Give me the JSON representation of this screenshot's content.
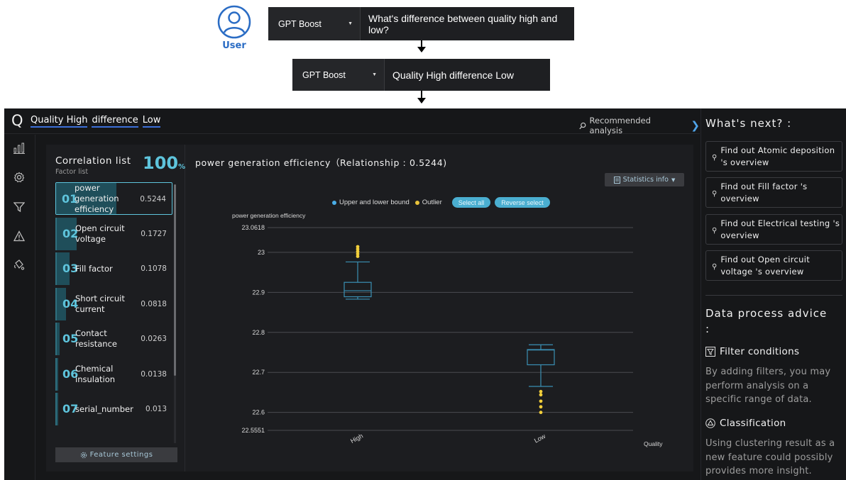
{
  "flow": {
    "user_label": "User",
    "query1": {
      "model": "GPT Boost",
      "text": "What's difference between quality high and low?"
    },
    "query2": {
      "model": "GPT Boost",
      "text": "Quality High difference Low"
    }
  },
  "app": {
    "logo": "Q",
    "breadcrumb": [
      "Quality High",
      "difference",
      "Low"
    ],
    "recommended": "Recommended analysis",
    "correlation": {
      "title": "Correlation list",
      "subtitle": "Factor list",
      "percent": "100",
      "percent_unit": "%",
      "factors": [
        {
          "num": "01",
          "name": "power generation efficiency",
          "value": "0.5244",
          "score": 0.5244,
          "active": true
        },
        {
          "num": "02",
          "name": "Open circuit voltage",
          "value": "0.1727",
          "score": 0.1727
        },
        {
          "num": "03",
          "name": "Fill factor",
          "value": "0.1078",
          "score": 0.1078
        },
        {
          "num": "04",
          "name": "Short circuit current",
          "value": "0.0818",
          "score": 0.0818
        },
        {
          "num": "05",
          "name": "Contact resistance",
          "value": "0.0263",
          "score": 0.0263
        },
        {
          "num": "06",
          "name": "Chemical insulation",
          "value": "0.0138",
          "score": 0.0138
        },
        {
          "num": "07",
          "name": "serial_number",
          "value": "0.013",
          "score": 0.013
        }
      ],
      "feature_settings": "Feature settings"
    },
    "chart_panel": {
      "title": "power generation efficiency（Relationship : 0.5244)",
      "stats_button": "Statistics info",
      "legend": {
        "bound": "Upper and lower bound",
        "outlier": "Outlier",
        "select_all": "Select all",
        "reverse_select": "Reverse select"
      }
    }
  },
  "chart_data": {
    "type": "box",
    "ylabel": "power generation efficiency",
    "xlabel": "Quality",
    "categories": [
      "High",
      "Low"
    ],
    "ylim": [
      22.5551,
      23.0618
    ],
    "yticks": [
      {
        "value": 23.0618,
        "label": "23.0618"
      },
      {
        "value": 23.0,
        "label": "23"
      },
      {
        "value": 22.9,
        "label": "22.9"
      },
      {
        "value": 22.8,
        "label": "22.8"
      },
      {
        "value": 22.7,
        "label": "22.7"
      },
      {
        "value": 22.6,
        "label": "22.6"
      },
      {
        "value": 22.5551,
        "label": "22.5551"
      }
    ],
    "boxes": [
      {
        "category": "High",
        "whisker_low": 22.883,
        "q1": 22.889,
        "median": 22.904,
        "q3": 22.925,
        "whisker_high": 22.976,
        "outliers": [
          22.99,
          22.996,
          23.002,
          23.008,
          23.014
        ]
      },
      {
        "category": "Low",
        "whisker_low": 22.665,
        "q1": 22.719,
        "median": 22.756,
        "q3": 22.757,
        "whisker_high": 22.769,
        "outliers": [
          22.6,
          22.614,
          22.628,
          22.644,
          22.652
        ]
      }
    ],
    "colors": {
      "box": "#3a8fb4",
      "outlier": "#f2cf3b",
      "grid": "#4a4b50",
      "bound_dot": "#4aaee8",
      "outlier_dot": "#e8c23b"
    }
  },
  "right_panel": {
    "next_title": "What's next? :",
    "next_items": [
      "Find out Atomic deposition 's overview",
      "Find out Fill factor 's overview",
      "Find out Electrical testing 's overview",
      "Find out Open circuit voltage 's overview"
    ],
    "advice_title": "Data process advice :",
    "advice": [
      {
        "head": "Filter conditions",
        "body": "By adding filters, you may perform analysis on a specific range of data."
      },
      {
        "head": "Classification",
        "body": "Using clustering result as a new feature could possibly provides more insight."
      }
    ]
  }
}
